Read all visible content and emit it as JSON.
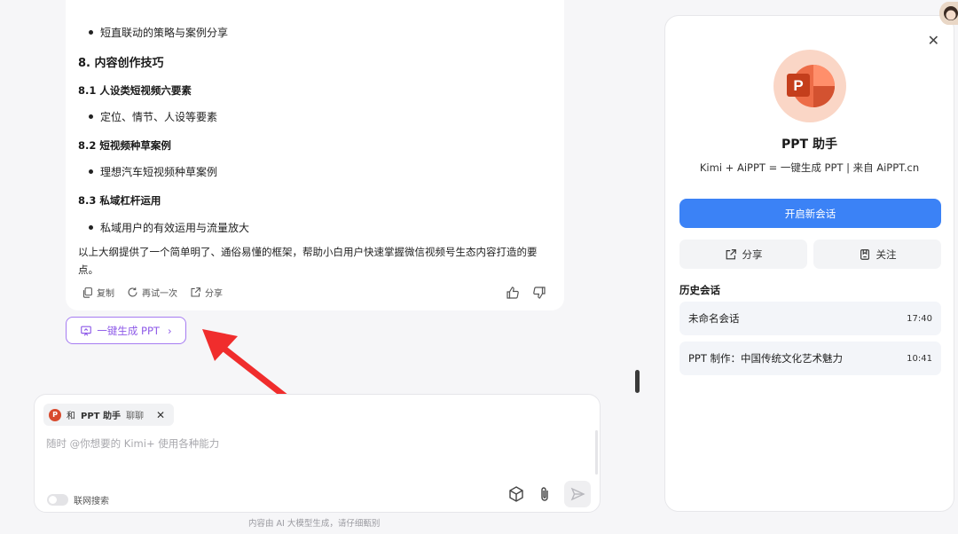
{
  "answer": {
    "top_bullet": "短直联动的策略与案例分享",
    "section8_title": "8. 内容创作技巧",
    "sub81_title": "8.1 人设类短视频六要素",
    "sub81_bullet": "定位、情节、人设等要素",
    "sub82_title": "8.2 短视频种草案例",
    "sub82_bullet": "理想汽车短视频种草案例",
    "sub83_title": "8.3 私域杠杆运用",
    "sub83_bullet": "私域用户的有效运用与流量放大",
    "summary": "以上大纲提供了一个简单明了、通俗易懂的框架，帮助小白用户快速掌握微信视频号生态内容打造的要点。",
    "actions": {
      "copy": "复制",
      "retry": "再试一次",
      "share": "分享"
    }
  },
  "ppt_button_label": "一键生成 PPT",
  "input": {
    "chip_prefix": "和",
    "chip_name": "PPT 助手",
    "chip_suffix": "聊聊",
    "placeholder": "随时 @你想要的 Kimi+ 使用各种能力",
    "web_search_label": "联网搜索"
  },
  "disclaimer": "内容由 AI 大模型生成，请仔细甄别",
  "panel": {
    "title": "PPT 助手",
    "subtitle": "Kimi + AiPPT = 一键生成 PPT | 来自 AiPPT.cn",
    "new_chat_label": "开启新会话",
    "share_label": "分享",
    "follow_label": "关注",
    "history_title": "历史会话",
    "history": [
      {
        "name": "未命名会话",
        "time": "17:40"
      },
      {
        "name": "PPT 制作：中国传统文化艺术魅力",
        "time": "10:41"
      }
    ]
  },
  "colors": {
    "accent_blue": "#3b82f6",
    "ppt_purple": "#8e5ae8",
    "arrow_red": "#f02d2d"
  }
}
